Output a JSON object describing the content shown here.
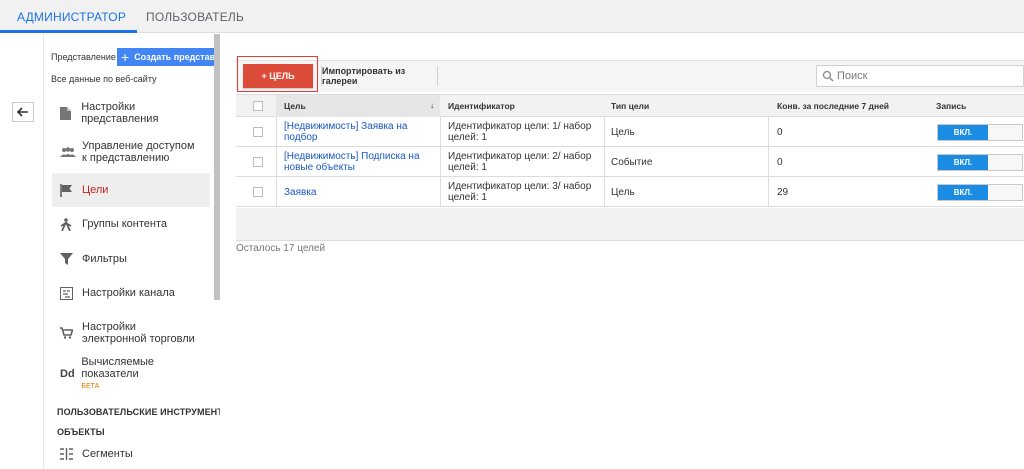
{
  "top_tabs": [
    {
      "label": "АДМИНИСТРАТОР",
      "active": true
    },
    {
      "label": "ПОЛЬЗОВАТЕЛЬ",
      "active": false
    }
  ],
  "sidebar": {
    "view_label": "Представление",
    "create_button": "Создать представл",
    "all_data_label": "Все данные по веб-сайту",
    "items": [
      {
        "label": "Настройки представления",
        "icon": "document-icon"
      },
      {
        "label": "Управление доступом к представлению",
        "icon": "people-icon"
      },
      {
        "label": "Цели",
        "icon": "flag-icon",
        "selected": true
      },
      {
        "label": "Группы контента",
        "icon": "walk-icon"
      },
      {
        "label": "Фильтры",
        "icon": "filter-icon"
      },
      {
        "label": "Настройки канала",
        "icon": "channel-icon"
      },
      {
        "label": "Настройки электронной торговли",
        "icon": "cart-icon"
      },
      {
        "label": "Вычисляемые показатели",
        "badge": "БЕТА",
        "icon": "dd-icon"
      }
    ],
    "section_title_line1": "ПОЛЬЗОВАТЕЛЬСКИЕ ИНСТРУМЕНТЫ И",
    "section_title_line2": "ОБЪЕКТЫ",
    "segments_label": "Сегменты"
  },
  "toolbar": {
    "new_goal_button": "+ ЦЕЛЬ",
    "import_button": "Импортировать из галереи",
    "search_placeholder": "Поиск"
  },
  "table": {
    "columns": [
      "Цель",
      "Идентификатор",
      "Тип цели",
      "Конв. за последние 7 дней",
      "Запись"
    ],
    "rows": [
      {
        "goal": "[Недвижимость] Заявка на подбор",
        "id": "Идентификатор цели: 1/ набор целей: 1",
        "type": "Цель",
        "conv": "0",
        "recording": "ВКЛ."
      },
      {
        "goal": "[Недвижимость] Подписка на новые объекты",
        "id": "Идентификатор цели: 2/ набор целей: 1",
        "type": "Событие",
        "conv": "0",
        "recording": "ВКЛ."
      },
      {
        "goal": "Заявка",
        "id": "Идентификатор цели: 3/ набор целей: 1",
        "type": "Цель",
        "conv": "29",
        "recording": "ВКЛ."
      }
    ],
    "remaining_text": "Осталось 17 целей"
  },
  "colors": {
    "accent": "#1a73e8",
    "goal_button": "#dd4b39",
    "toggle_on": "#1a8ce3",
    "selected_text": "#c5221f"
  }
}
